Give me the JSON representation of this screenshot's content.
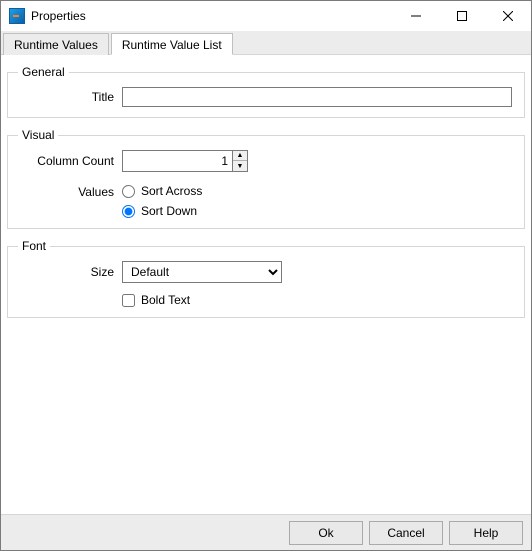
{
  "titlebar": {
    "title": "Properties"
  },
  "tabs": {
    "runtime_values": "Runtime Values",
    "runtime_value_list": "Runtime Value List"
  },
  "general": {
    "legend": "General",
    "title_label": "Title",
    "title_value": ""
  },
  "visual": {
    "legend": "Visual",
    "column_count_label": "Column Count",
    "column_count_value": "1",
    "values_label": "Values",
    "sort_across_label": "Sort Across",
    "sort_down_label": "Sort Down",
    "sort_selected": "down"
  },
  "font": {
    "legend": "Font",
    "size_label": "Size",
    "size_value": "Default",
    "bold_label": "Bold Text",
    "bold_checked": false
  },
  "buttons": {
    "ok": "Ok",
    "cancel": "Cancel",
    "help": "Help"
  }
}
